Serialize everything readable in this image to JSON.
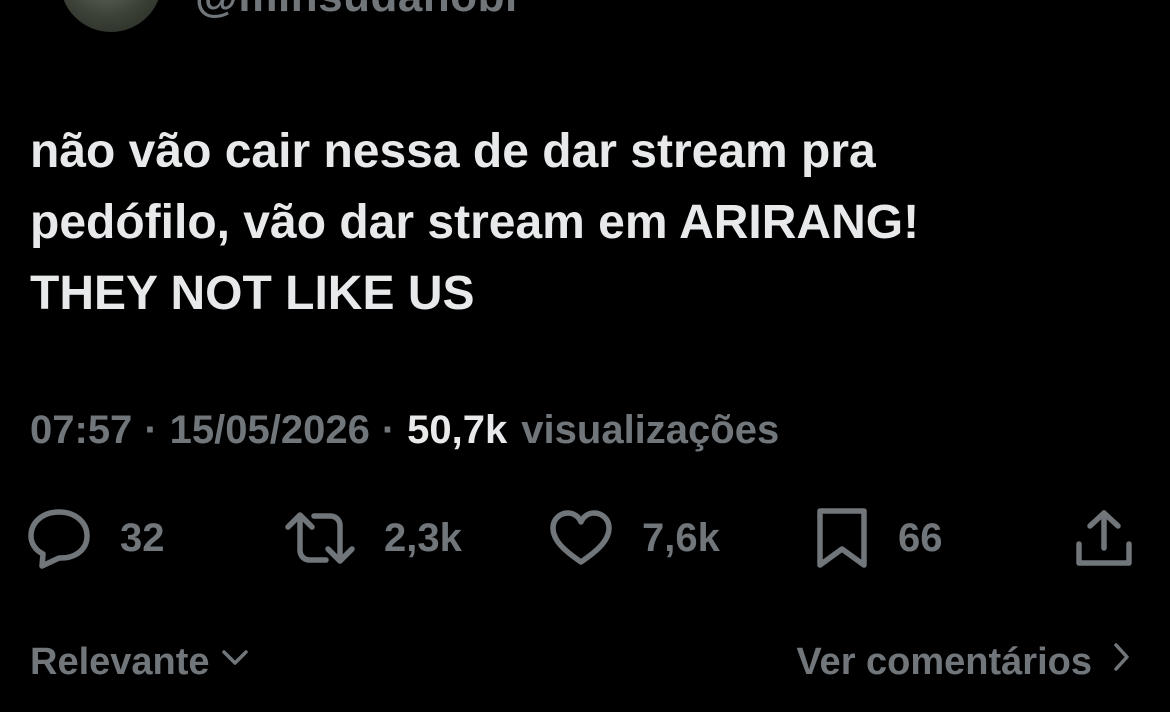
{
  "author": {
    "handle": "@minsudanobr"
  },
  "tweet": {
    "text_lines": [
      "não vão cair nessa de dar stream pra",
      "pedófilo, vão dar stream em ARIRANG!",
      "THEY NOT LIKE US"
    ],
    "time": "07:57",
    "separator": "·",
    "date": "15/05/2026",
    "views_count": "50,7k",
    "views_label": "visualizações"
  },
  "actions": {
    "reply": {
      "icon": "reply-icon",
      "count": "32"
    },
    "retweet": {
      "icon": "retweet-icon",
      "count": "2,3k"
    },
    "like": {
      "icon": "heart-icon",
      "count": "7,6k"
    },
    "bookmark": {
      "icon": "bookmark-icon",
      "count": "66"
    },
    "share": {
      "icon": "share-icon"
    }
  },
  "footer": {
    "sort_label": "Relevante",
    "sort_icon": "chevron-down-icon",
    "comments_label": "Ver comentários",
    "comments_icon": "chevron-right-icon"
  },
  "colors": {
    "background": "#000000",
    "primary_text": "#e7e9ea",
    "secondary_text": "#71767b"
  }
}
